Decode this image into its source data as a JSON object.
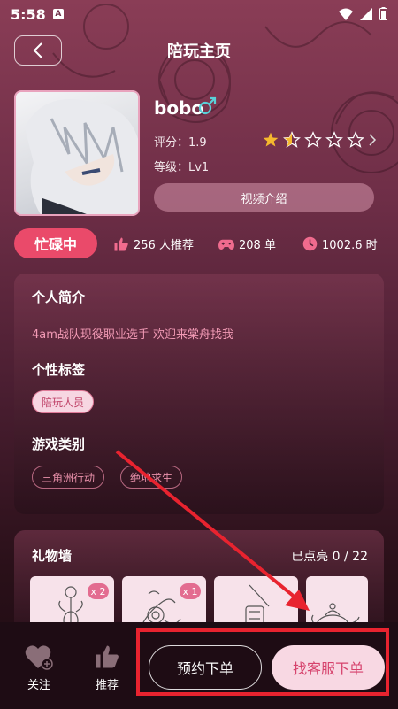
{
  "status_bar": {
    "time": "5:58",
    "notif_letter": "A"
  },
  "header": {
    "title": "陪玩主页"
  },
  "profile": {
    "name": "bobo",
    "rating_label": "评分：1.9",
    "rating_value": 1.9,
    "rating_max": 5,
    "level_label": "等级：Lv1",
    "video_button": "视频介绍"
  },
  "stats": {
    "status_button": "忙碌中",
    "recommend": "256 人推荐",
    "orders": "208 单",
    "hours": "1002.6 时"
  },
  "intro": {
    "bio_title": "个人简介",
    "bio_text": "4am战队现役职业选手 欢迎来棠舟找我",
    "tags_title": "个性标签",
    "tags": [
      "陪玩人员"
    ],
    "games_title": "游戏类别",
    "games": [
      "三角洲行动",
      "绝地求生"
    ]
  },
  "gifts": {
    "title": "礼物墙",
    "count": "已点亮 0 / 22",
    "items": [
      {
        "badge": "x 2"
      },
      {
        "badge": "x 1"
      },
      {
        "badge": ""
      },
      {
        "badge": ""
      }
    ]
  },
  "bottom": {
    "follow": "关注",
    "recommend": "推荐",
    "reserve": "预约下单",
    "service": "找客服下单"
  },
  "colors": {
    "accent": "#ea4a6a",
    "pink_light": "#f8d8e3",
    "annotation": "#e8232f"
  }
}
